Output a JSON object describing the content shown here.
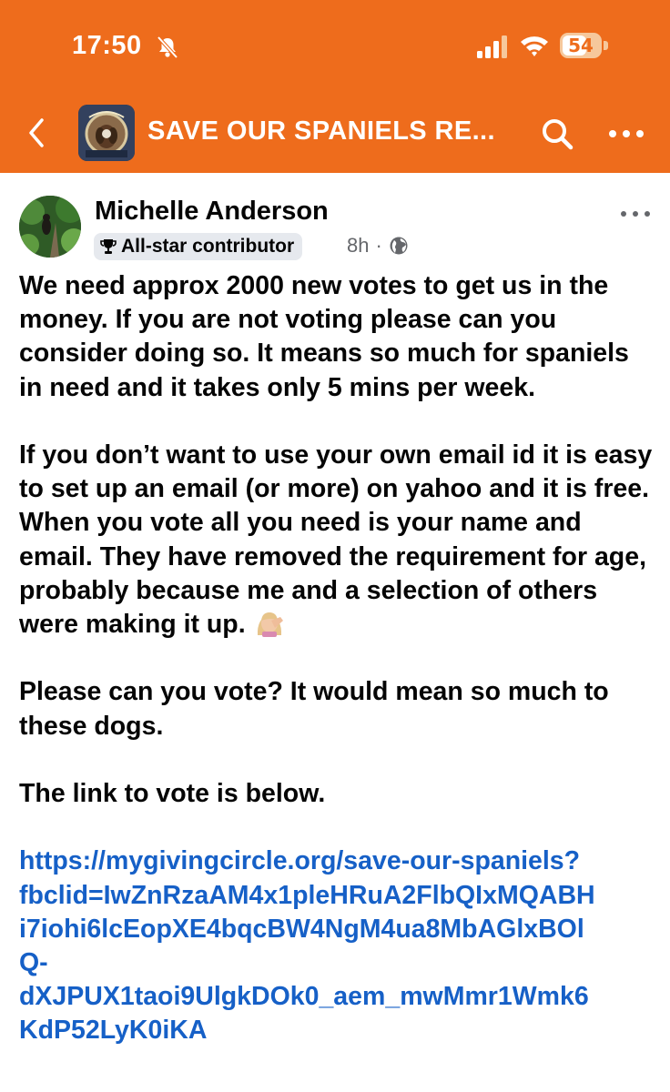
{
  "status_bar": {
    "time": "17:50",
    "battery": "54",
    "icons": [
      "bell-slash-icon",
      "cellular-signal-icon",
      "wifi-icon",
      "battery-icon"
    ]
  },
  "header": {
    "group_title": "SAVE OUR SPANIELS RE...",
    "icons": [
      "chevron-left-icon",
      "group-thumbnail",
      "search-icon",
      "more-dots-icon"
    ],
    "colors": {
      "accent": "#ee6c1c",
      "text": "#ffffff"
    }
  },
  "post": {
    "author": "Michelle Anderson",
    "badge": "All-star contributor",
    "time": "8h",
    "separator": "·",
    "audience_icon": "globe-icon",
    "paragraphs": [
      "We need approx 2000 new votes to get us in the money. If you are not voting please can you consider doing so. It means so much for spaniels in need and it takes only 5 mins per week.",
      "If you don’t want to use your own email id it is easy to set up an email (or more) on yahoo and it is free. When you vote all you need is your name and email. They have removed the requirement for age, probably because me and a selection of others were making it up.",
      "Please can you vote? It would mean so much to these dogs.",
      "The link to vote is below."
    ],
    "emoji": "face-palm-emoji",
    "link": "https://mygivingcircle.org/save-our-spaniels?\nfbclid=IwZnRzaAM4x1pleHRuA2FlbQIxMQABH\ni7iohi6lcEopXE4bqcBW4NgM4ua8MbAGlxBOl\nQ-\ndXJPUX1taoi9UlgkDOk0_aem_mwMmr1Wmk6\nKdP52LyK0iKA",
    "colors": {
      "link": "#1660c7",
      "meta": "#65676b",
      "badge_bg": "#e6e9ee"
    }
  }
}
